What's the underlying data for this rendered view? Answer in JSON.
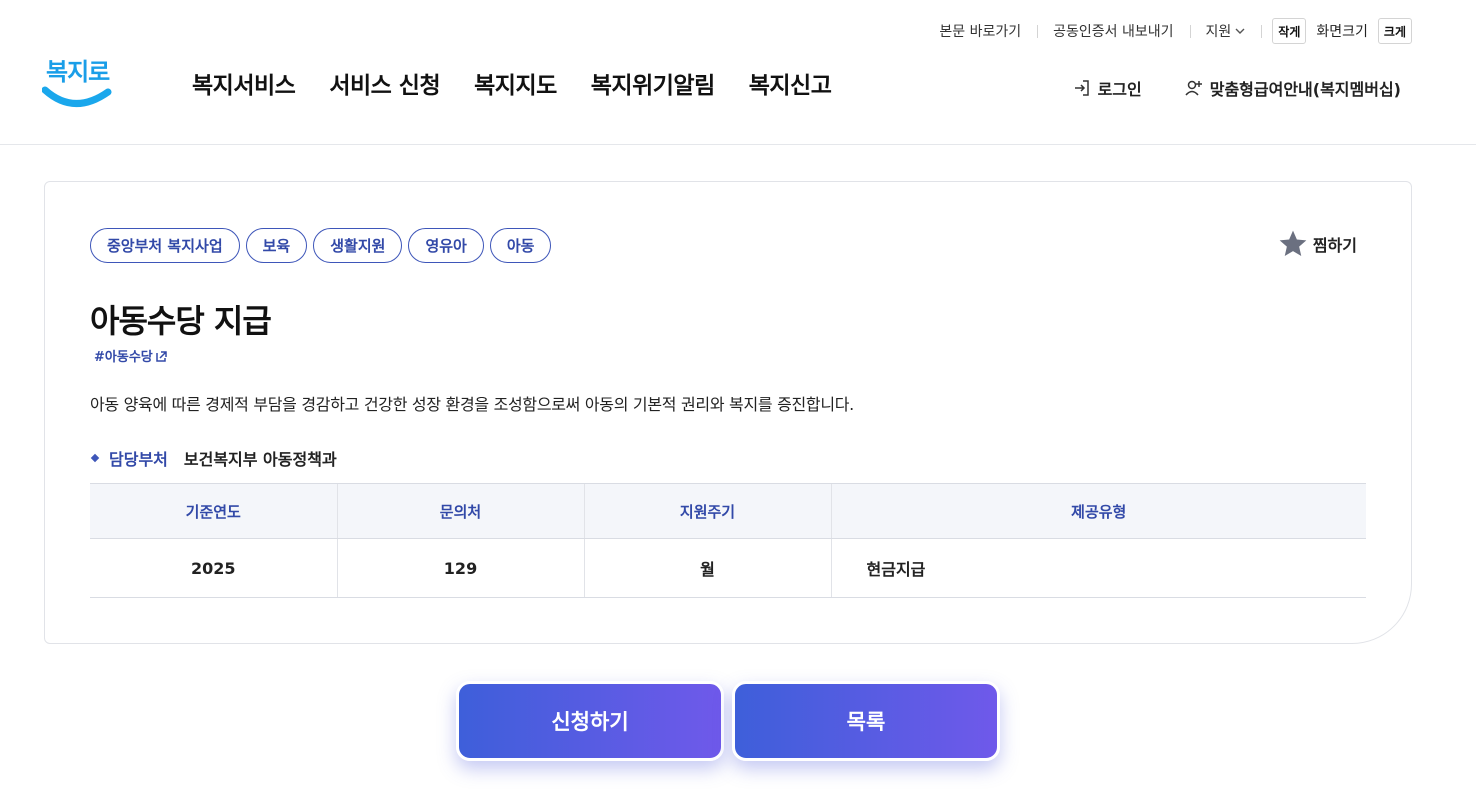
{
  "header": {
    "logo_text": "복지로",
    "util_links": {
      "skip_to_content": "본문 바로가기",
      "export_cert": "공동인증서 내보내기",
      "language": "지원"
    },
    "font_size": {
      "small": "작게",
      "label": "화면크기",
      "large": "크게"
    },
    "nav": [
      "복지서비스",
      "서비스 신청",
      "복지지도",
      "복지위기알림",
      "복지신고"
    ],
    "member": {
      "login": "로그인",
      "membership": "맞춤형급여안내(복지멤버십)"
    }
  },
  "service": {
    "tags": [
      "중앙부처 복지사업",
      "보육",
      "생활지원",
      "영유아",
      "아동"
    ],
    "wish_label": "찜하기",
    "title": "아동수당 지급",
    "hashtag": "#아동수당",
    "description": "아동 양육에 따른 경제적 부담을 경감하고 건강한 성장 환경을 조성함으로써 아동의 기본적 권리와 복지를 증진합니다.",
    "dept_label": "담당부처",
    "dept_value": "보건복지부 아동정책과",
    "table": {
      "headers": [
        "기준연도",
        "문의처",
        "지원주기",
        "제공유형"
      ],
      "row": [
        "2025",
        "129",
        "월",
        "현금지급"
      ]
    }
  },
  "actions": {
    "apply": "신청하기",
    "list": "목록"
  },
  "colors": {
    "brand_blue": "#3249a8",
    "logo_blue": "#1a9ee8",
    "button_gradient_start": "#3e5fda",
    "button_gradient_end": "#6f59ea"
  }
}
